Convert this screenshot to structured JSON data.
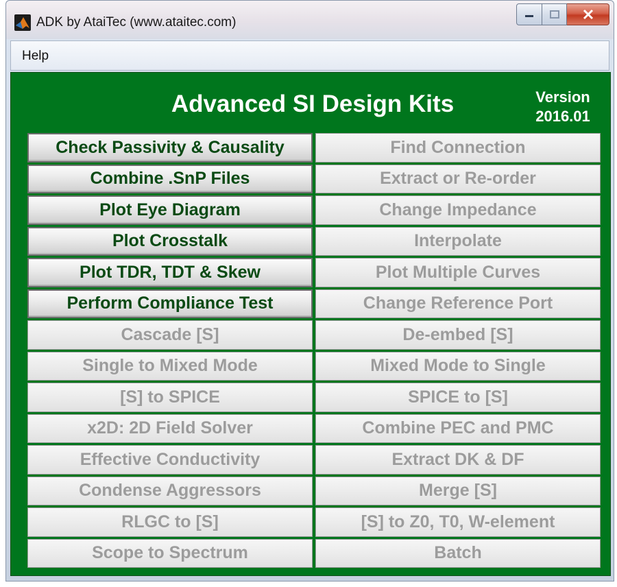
{
  "window": {
    "title": "ADK by AtaiTec (www.ataitec.com)",
    "icon": "matlab-logo-icon"
  },
  "menu": {
    "items": [
      "Help"
    ]
  },
  "panel": {
    "title": "Advanced SI Design Kits",
    "version_label": "Version",
    "version_number": "2016.01",
    "background_color": "#00761d"
  },
  "buttons": [
    {
      "label": "Check Passivity & Causality",
      "enabled": true
    },
    {
      "label": "Find Connection",
      "enabled": false
    },
    {
      "label": "Combine .SnP Files",
      "enabled": true
    },
    {
      "label": "Extract or Re-order",
      "enabled": false
    },
    {
      "label": "Plot Eye Diagram",
      "enabled": true
    },
    {
      "label": "Change Impedance",
      "enabled": false
    },
    {
      "label": "Plot Crosstalk",
      "enabled": true
    },
    {
      "label": "Interpolate",
      "enabled": false
    },
    {
      "label": "Plot TDR, TDT & Skew",
      "enabled": true
    },
    {
      "label": "Plot Multiple Curves",
      "enabled": false
    },
    {
      "label": "Perform Compliance Test",
      "enabled": true
    },
    {
      "label": "Change Reference Port",
      "enabled": false
    },
    {
      "label": "Cascade [S]",
      "enabled": false
    },
    {
      "label": "De-embed [S]",
      "enabled": false
    },
    {
      "label": "Single to Mixed Mode",
      "enabled": false
    },
    {
      "label": "Mixed Mode to Single",
      "enabled": false
    },
    {
      "label": "[S] to SPICE",
      "enabled": false
    },
    {
      "label": "SPICE to [S]",
      "enabled": false
    },
    {
      "label": "x2D: 2D Field Solver",
      "enabled": false
    },
    {
      "label": "Combine PEC and PMC",
      "enabled": false
    },
    {
      "label": "Effective Conductivity",
      "enabled": false
    },
    {
      "label": "Extract DK & DF",
      "enabled": false
    },
    {
      "label": "Condense Aggressors",
      "enabled": false
    },
    {
      "label": "Merge [S]",
      "enabled": false
    },
    {
      "label": "RLGC to [S]",
      "enabled": false
    },
    {
      "label": "[S] to Z0, T0, W-element",
      "enabled": false
    },
    {
      "label": "Scope to Spectrum",
      "enabled": false
    },
    {
      "label": "Batch",
      "enabled": false
    }
  ]
}
